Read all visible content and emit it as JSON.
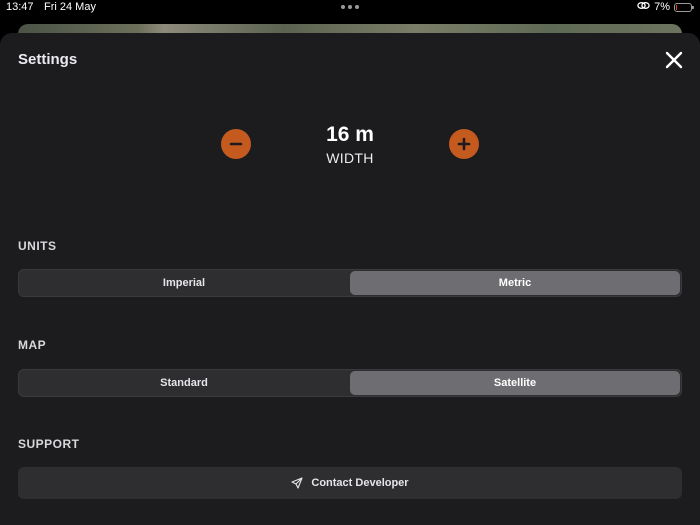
{
  "status_bar": {
    "time": "13:47",
    "date": "Fri 24 May",
    "battery_percent": "7%",
    "battery_level": 0.07
  },
  "sheet": {
    "title": "Settings",
    "close_icon": "close-icon"
  },
  "width_control": {
    "value": "16 m",
    "label": "WIDTH",
    "accent_color": "#c55a1f",
    "decrease_icon": "minus-icon",
    "increase_icon": "plus-icon"
  },
  "units": {
    "heading": "UNITS",
    "options": [
      "Imperial",
      "Metric"
    ],
    "selected": "Metric"
  },
  "map": {
    "heading": "MAP",
    "options": [
      "Standard",
      "Satellite"
    ],
    "selected": "Satellite"
  },
  "support": {
    "heading": "SUPPORT",
    "contact_label": "Contact Developer",
    "contact_icon": "paper-plane-icon"
  }
}
